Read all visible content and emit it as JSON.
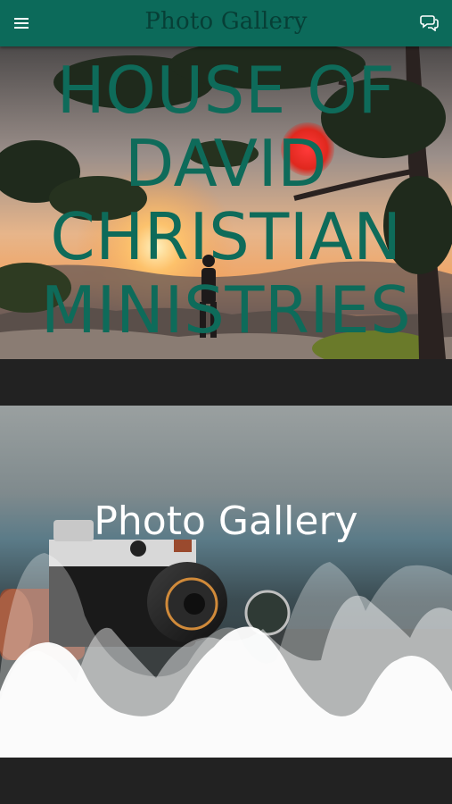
{
  "header": {
    "title": "Photo Gallery",
    "menu_icon": "hamburger-menu-icon",
    "chat_icon": "chat-bubbles-icon",
    "bg_color": "#0c6a5a",
    "title_color": "#073f36"
  },
  "hero": {
    "title": "HOUSE OF DAVID CHRISTIAN MINISTRIES",
    "title_color": "#0e6b5a"
  },
  "gallery_card": {
    "title": "Photo Gallery"
  },
  "bottom": {
    "text": ""
  }
}
